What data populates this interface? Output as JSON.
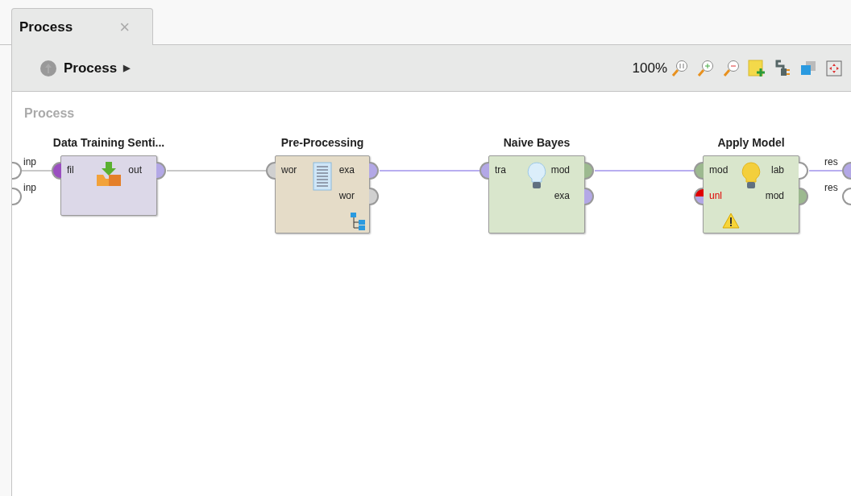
{
  "tab": {
    "label": "Process",
    "close": "×",
    "selected": true
  },
  "breadcrumb": {
    "label": "Process",
    "arrow": "▶"
  },
  "toolbar": {
    "zoom": "100%"
  },
  "canvas": {
    "label": "Process",
    "process_inputs": [
      {
        "label": "inp",
        "color": "#ffffff"
      },
      {
        "label": "inp",
        "color": "#ffffff"
      }
    ],
    "process_outputs": [
      {
        "label": "res",
        "color": "#b3a8e6"
      },
      {
        "label": "res",
        "color": "#ffffff"
      }
    ],
    "operators": [
      {
        "title": "Data Training Senti...",
        "kind": "import",
        "color": "#dcd8e8",
        "inputs": [
          {
            "label": "fil",
            "color": "#9a4fc0",
            "error": false
          }
        ],
        "outputs": [
          {
            "label": "out",
            "color": "#b3a8e6"
          }
        ]
      },
      {
        "title": "Pre-Processing",
        "kind": "document",
        "badge": {
          "kind": "subprocess"
        },
        "color": "#e5dcc8",
        "inputs": [
          {
            "label": "wor",
            "color": "#d0d0d0",
            "error": false
          }
        ],
        "outputs": [
          {
            "label": "exa",
            "color": "#b3a8e6"
          },
          {
            "label": "wor",
            "color": "#d0d0d0"
          }
        ]
      },
      {
        "title": "Naive Bayes",
        "kind": "model-light",
        "color": "#d9e6cc",
        "inputs": [
          {
            "label": "tra",
            "color": "#b3a8e6",
            "error": false
          }
        ],
        "outputs": [
          {
            "label": "mod",
            "color": "#9cb98f"
          },
          {
            "label": "exa",
            "color": "#b3a8e6"
          }
        ]
      },
      {
        "title": "Apply Model",
        "kind": "model-yellow",
        "badge": {
          "kind": "warning"
        },
        "color": "#d9e6cc",
        "inputs": [
          {
            "label": "mod",
            "color": "#9cb98f",
            "error": false
          },
          {
            "label": "unl",
            "color": "#b3a8e6",
            "error": true
          }
        ],
        "outputs": [
          {
            "label": "lab",
            "color": "#ffffff"
          },
          {
            "label": "mod",
            "color": "#9cb98f"
          }
        ]
      }
    ],
    "connections": [
      {
        "color": "#c8c8c8"
      },
      {
        "color": "#c8c8c8"
      },
      {
        "color": "#b8aef0"
      },
      {
        "color": "#b8aef0"
      },
      {
        "color": "#b8aef0"
      }
    ]
  }
}
